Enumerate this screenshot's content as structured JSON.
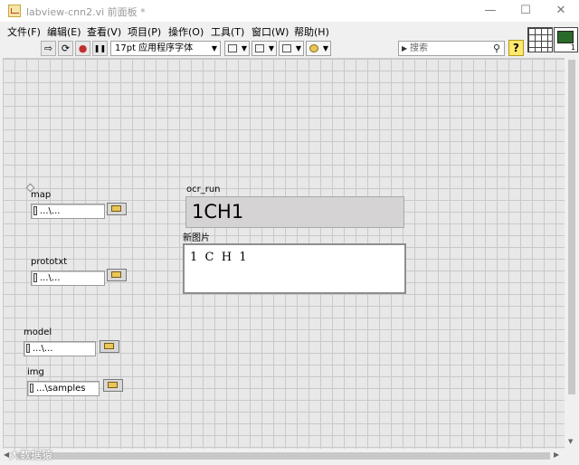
{
  "window": {
    "title": "labview-cnn2.vi 前面板 *",
    "controls": {
      "minimize": "—",
      "maximize": "☐",
      "close": "✕"
    }
  },
  "menu": [
    "文件(F)",
    "编辑(E)",
    "查看(V)",
    "项目(P)",
    "操作(O)",
    "工具(T)",
    "窗口(W)",
    "帮助(H)"
  ],
  "toolbar": {
    "run_icon": "⇨",
    "run_continuous_icon": "⟳",
    "abort_icon": "●",
    "pause_icon": "❚❚",
    "font_selector": "17pt 应用程序字体",
    "search_placeholder": "搜索",
    "search_icon": "magnifier-icon",
    "help_icon": "?"
  },
  "vi_icon_number": "1",
  "front_panel": {
    "controls": [
      {
        "label": "map",
        "value": "...\\..."
      },
      {
        "label": "prototxt",
        "value": "...\\..."
      },
      {
        "label": "model",
        "value": "...\\..."
      },
      {
        "label": "img",
        "value": "...\\samples"
      }
    ],
    "ocr_run": {
      "label": "ocr_run",
      "value": "1CH1"
    },
    "new_image": {
      "label": "新图片",
      "text": "1  C  H  1"
    }
  },
  "watermark": "大数据猿",
  "colors": {
    "panel_background": "#e8e8e8",
    "grid_line": "#c9c9c9",
    "string_indicator": "#d6d3d4",
    "help_button": "#ffe86b"
  }
}
